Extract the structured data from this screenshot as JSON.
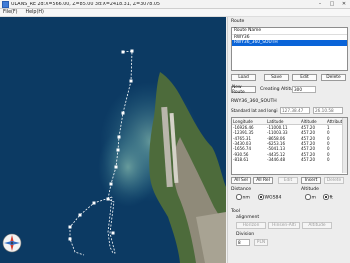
{
  "window": {
    "title": "ULANS_RE 2d:X=566.00, Z=85.00 3d:X=2418.31, Z=3078.05",
    "minimize_glyph": "–",
    "maximize_glyph": "□",
    "close_glyph": "✕"
  },
  "menu": {
    "file": "File(F)",
    "help": "Help(H)"
  },
  "panel": {
    "route_section": "Route",
    "route_list": {
      "header": "Route Name",
      "items": [
        "RWY36",
        "RWY36_360_SOUTH"
      ],
      "selected_index": 1
    },
    "buttons": {
      "load": "Load",
      "save": "Save",
      "edit": "Edit",
      "delete": "Delete",
      "new_route": "New Route"
    },
    "creating_altitude_label": "Creating Altitude",
    "creating_altitude_value": "300",
    "current_route_name": "RWY36_360_SOUTH",
    "standard_latlong_label": "Standard lat and longi",
    "standard_lat_value": "127.38.47",
    "standard_long_value": "26.10.58",
    "waypoint_table": {
      "columns": [
        "Longitude",
        "Latitude",
        "Altitude",
        "Attributi"
      ],
      "rows": [
        [
          "-16926.46",
          "-11000.11",
          "457.20",
          "1"
        ],
        [
          "-12391.35",
          "-11003.33",
          "457.20",
          "0"
        ],
        [
          "-4765.31",
          "-8658.06",
          "457.20",
          "0"
        ],
        [
          "-3430.03",
          "-6253.16",
          "457.20",
          "0"
        ],
        [
          "-1656.74",
          "-5041.13",
          "457.20",
          "0"
        ],
        [
          "-930.56",
          "-4435.12",
          "457.20",
          "0"
        ],
        [
          "-818.61",
          "-3446.48",
          "457.20",
          "0"
        ]
      ]
    },
    "waypoint_buttons": {
      "all_sel": "All Sel",
      "all_rel": "All Rel",
      "edit": "Edit",
      "insert": "Insert",
      "delete": "Delete"
    },
    "distance": {
      "label": "Distance",
      "options": [
        "nm",
        "WGS84"
      ],
      "selected": "nm"
    },
    "altitude": {
      "label": "Altitude",
      "options": [
        "m",
        "ft"
      ],
      "selected": "ft"
    },
    "tool": {
      "label": "Tool",
      "alignment_label": "alignment",
      "alignment_buttons": [
        "Horizon",
        "Hinsen-Alti",
        "Altitude"
      ],
      "division_label": "Division",
      "division_value": "8",
      "division_button": "PLN"
    }
  },
  "colors": {
    "selection": "#0a64d8",
    "sea": "#0c3a63",
    "route_line": "#ffffff"
  }
}
